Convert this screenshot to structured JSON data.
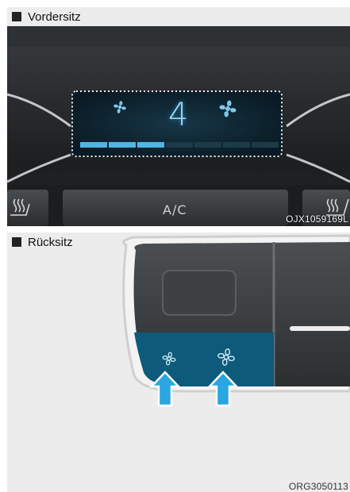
{
  "front": {
    "caption": "Vordersitz",
    "fan_speed": "4",
    "ac_label": "A/C",
    "figure_code": "OJX1059169L",
    "fan_level_segments_lit": 3,
    "fan_level_segments_total": 7,
    "display_color": "#9fd6f2",
    "icons": [
      "fan-small-icon",
      "fan-large-icon",
      "seat-heater-left-icon",
      "seat-heater-right-icon"
    ]
  },
  "rear": {
    "caption": "Rücksitz",
    "figure_code": "ORG3050113",
    "highlight_color": "#0d5a7a",
    "arrow_color": "#2aa6e0",
    "icons": [
      "fan-small-icon",
      "fan-large-icon",
      "arrow-up-icon"
    ]
  }
}
